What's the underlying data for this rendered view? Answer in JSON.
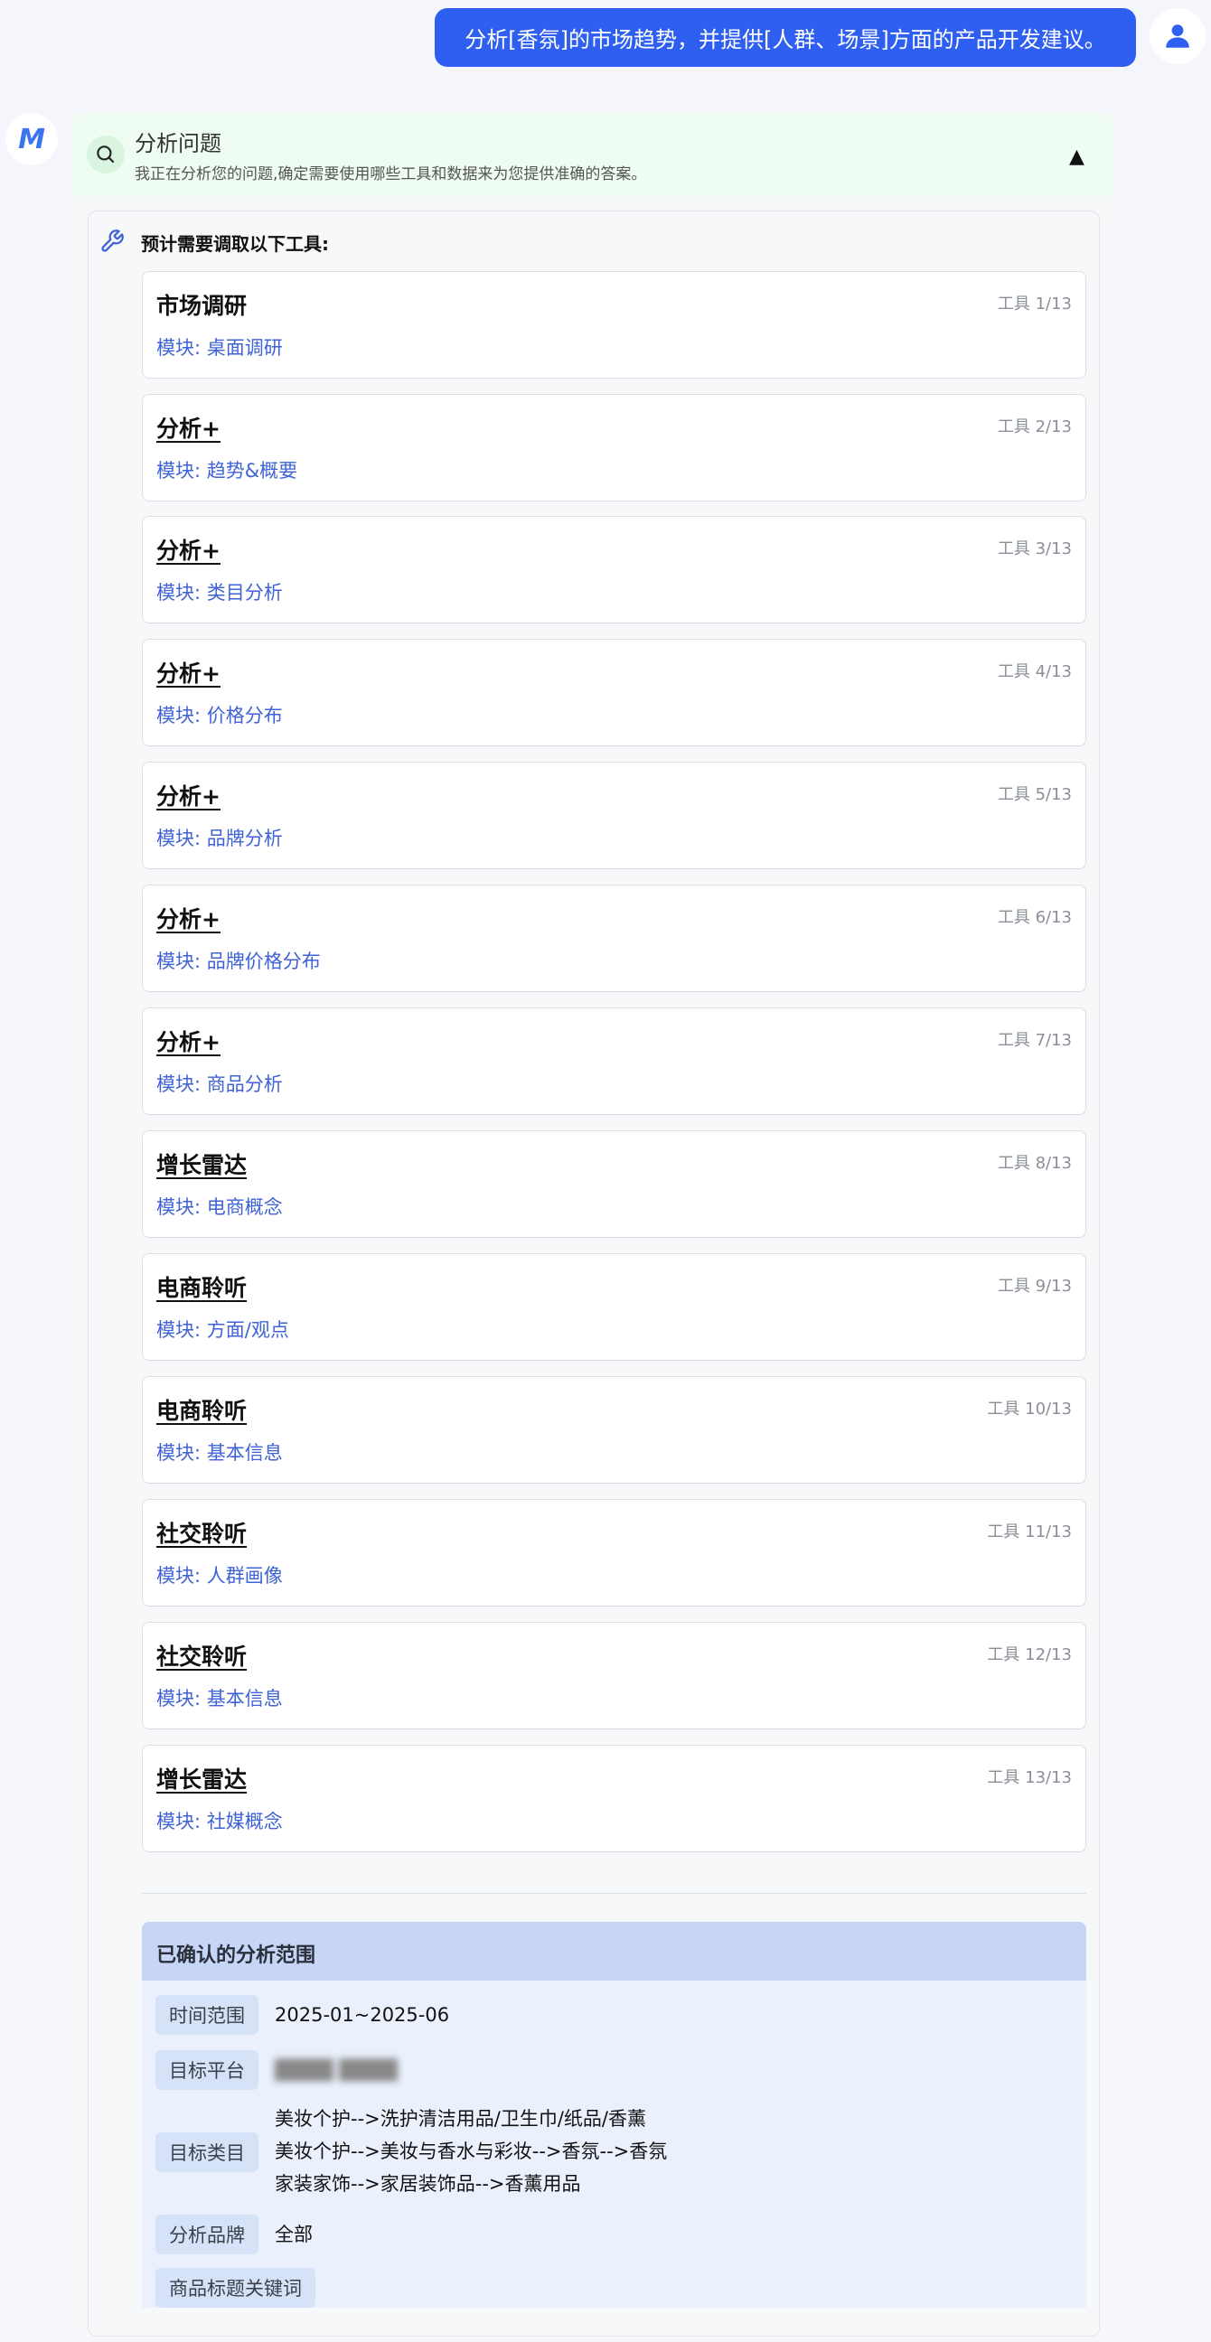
{
  "user_message": "分析[香氛]的市场趋势，并提供[人群、场景]方面的产品开发建议。",
  "user_avatar_icon": "user-icon",
  "bot_logo_text": "M",
  "analysis": {
    "title": "分析问题",
    "subtitle": "我正在分析您的问题,确定需要使用哪些工具和数据来为您提供准确的答案。",
    "collapse_glyph": "▲"
  },
  "tools_heading": "预计需要调取以下工具:",
  "tools": [
    {
      "name": "市场调研",
      "count": "工具 1/13",
      "module": "模块: 桌面调研"
    },
    {
      "name": "分析+",
      "count": "工具 2/13",
      "module": "模块: 趋势&概要"
    },
    {
      "name": "分析+",
      "count": "工具 3/13",
      "module": "模块: 类目分析"
    },
    {
      "name": "分析+",
      "count": "工具 4/13",
      "module": "模块: 价格分布"
    },
    {
      "name": "分析+",
      "count": "工具 5/13",
      "module": "模块: 品牌分析"
    },
    {
      "name": "分析+",
      "count": "工具 6/13",
      "module": "模块: 品牌价格分布"
    },
    {
      "name": "分析+",
      "count": "工具 7/13",
      "module": "模块: 商品分析"
    },
    {
      "name": "增长雷达",
      "count": "工具 8/13",
      "module": "模块: 电商概念"
    },
    {
      "name": "电商聆听",
      "count": "工具 9/13",
      "module": "模块: 方面/观点"
    },
    {
      "name": "电商聆听",
      "count": "工具 10/13",
      "module": "模块: 基本信息"
    },
    {
      "name": "社交聆听",
      "count": "工具 11/13",
      "module": "模块: 人群画像"
    },
    {
      "name": "社交聆听",
      "count": "工具 12/13",
      "module": "模块: 基本信息"
    },
    {
      "name": "增长雷达",
      "count": "工具 13/13",
      "module": "模块: 社媒概念"
    }
  ],
  "scope": {
    "title": "已确认的分析范围",
    "time_label": "时间范围",
    "time_value": "2025-01~2025-06",
    "platform_label": "目标平台",
    "platform_value": "████ ████",
    "category_label": "目标类目",
    "category_lines": [
      "美妆个护-->洗护清洁用品/卫生巾/纸品/香薰",
      "美妆个护-->美妆与香水与彩妆-->香氛-->香氛",
      "家装家饰-->家居装饰品-->香薰用品"
    ],
    "brand_label": "分析品牌",
    "brand_value": "全部",
    "keyword_label": "商品标题关键词"
  }
}
